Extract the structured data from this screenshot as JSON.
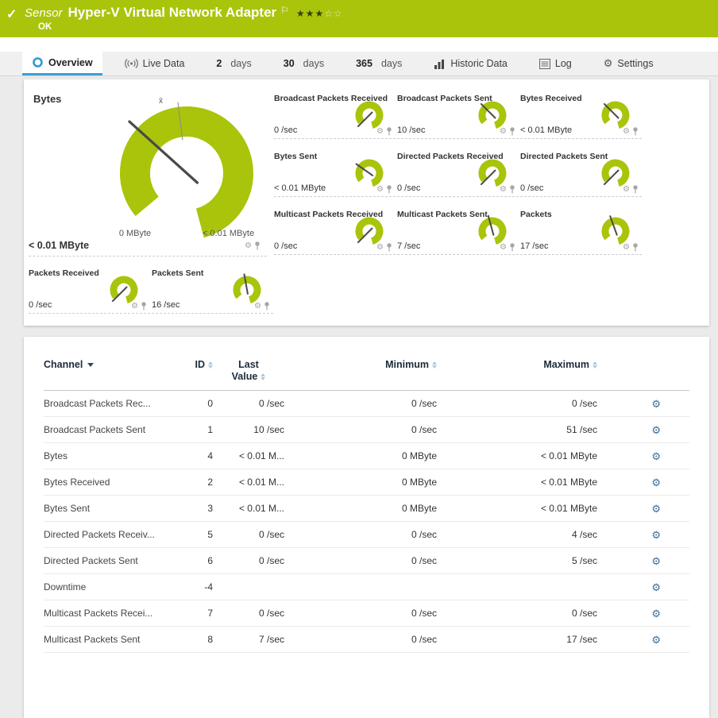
{
  "colors": {
    "green": "#aac40b",
    "gauge_green": "#aac40b",
    "accent_blue": "#3c9fd4"
  },
  "icons": {
    "check": "✓",
    "flag": "⚐",
    "gear": "⚙"
  },
  "header": {
    "kind": "Sensor",
    "title": "Hyper-V Virtual Network Adapter",
    "status": "OK",
    "stars_filled": "★★★",
    "stars_empty": "☆☆"
  },
  "tabs": [
    {
      "label": "Overview"
    },
    {
      "label": "Live Data"
    },
    {
      "num": "2",
      "label": "days"
    },
    {
      "num": "30",
      "label": "days"
    },
    {
      "num": "365",
      "label": "days"
    },
    {
      "label": "Historic Data"
    },
    {
      "label": "Log"
    },
    {
      "label": "Settings"
    }
  ],
  "gauge_panel": {
    "title": "Bytes",
    "big_gauge": {
      "name": "Bytes",
      "value": "< 0.01 MByte",
      "scale_min": "0 MByte",
      "scale_max": "< 0.01 MByte",
      "avg_marker": "x̄",
      "needle_angle": 312
    },
    "small_gauges": [
      {
        "title": "Broadcast Packets Received",
        "value": "0 /sec",
        "needle_angle": 225
      },
      {
        "title": "Broadcast Packets Sent",
        "value": "10 /sec",
        "needle_angle": 315
      },
      {
        "title": "Bytes Received",
        "value": "< 0.01 MByte",
        "needle_angle": 315
      },
      {
        "title": "Bytes Sent",
        "value": "< 0.01 MByte",
        "needle_angle": 305
      },
      {
        "title": "Directed Packets Received",
        "value": "0 /sec",
        "needle_angle": 225
      },
      {
        "title": "Directed Packets Sent",
        "value": "0 /sec",
        "needle_angle": 225
      },
      {
        "title": "Multicast Packets Received",
        "value": "0 /sec",
        "needle_angle": 225
      },
      {
        "title": "Multicast Packets Sent",
        "value": "7 /sec",
        "needle_angle": 345
      },
      {
        "title": "Packets",
        "value": "17 /sec",
        "needle_angle": 340
      },
      {
        "title": "Packets Received",
        "value": "0 /sec",
        "needle_angle": 225
      },
      {
        "title": "Packets Sent",
        "value": "16 /sec",
        "needle_angle": 350
      }
    ]
  },
  "table": {
    "header": {
      "channel": "Channel",
      "id": "ID",
      "last_value": "Last Value",
      "minimum": "Minimum",
      "maximum": "Maximum"
    },
    "rows": [
      {
        "channel": "Broadcast Packets Rec...",
        "id": "0",
        "last": "0 /sec",
        "min": "0 /sec",
        "max": "0 /sec"
      },
      {
        "channel": "Broadcast Packets Sent",
        "id": "1",
        "last": "10 /sec",
        "min": "0 /sec",
        "max": "51 /sec"
      },
      {
        "channel": "Bytes",
        "id": "4",
        "last": "< 0.01 M...",
        "min": "0 MByte",
        "max": "< 0.01 MByte"
      },
      {
        "channel": "Bytes Received",
        "id": "2",
        "last": "< 0.01 M...",
        "min": "0 MByte",
        "max": "< 0.01 MByte"
      },
      {
        "channel": "Bytes Sent",
        "id": "3",
        "last": "< 0.01 M...",
        "min": "0 MByte",
        "max": "< 0.01 MByte"
      },
      {
        "channel": "Directed Packets Receiv...",
        "id": "5",
        "last": "0 /sec",
        "min": "0 /sec",
        "max": "4 /sec"
      },
      {
        "channel": "Directed Packets Sent",
        "id": "6",
        "last": "0 /sec",
        "min": "0 /sec",
        "max": "5 /sec"
      },
      {
        "channel": "Downtime",
        "id": "-4",
        "last": "",
        "min": "",
        "max": ""
      },
      {
        "channel": "Multicast Packets Recei...",
        "id": "7",
        "last": "0 /sec",
        "min": "0 /sec",
        "max": "0 /sec"
      },
      {
        "channel": "Multicast Packets Sent",
        "id": "8",
        "last": "7 /sec",
        "min": "0 /sec",
        "max": "17 /sec"
      }
    ]
  }
}
